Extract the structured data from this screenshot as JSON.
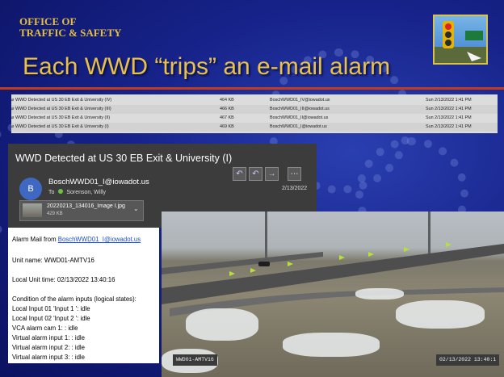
{
  "header": {
    "office_line1": "OFFICE OF",
    "office_line2": "TRAFFIC & SAFETY",
    "title": "Each WWD “trips” an e-mail alarm"
  },
  "email_list": [
    {
      "subject": "WWD Detected at US 30 EB Exit & University (IV)",
      "size": "464 KB",
      "from": "BoschWWD01_IV@iowadot.us",
      "date": "Sun 2/13/2022 1:41 PM"
    },
    {
      "subject": "WWD Detected at US 30 EB Exit & University (III)",
      "size": "466 KB",
      "from": "BoschWWD01_III@iowadot.us",
      "date": "Sun 2/13/2022 1:41 PM"
    },
    {
      "subject": "WWD Detected at US 30 EB Exit & University (II)",
      "size": "467 KB",
      "from": "BoschWWD01_II@iowadot.us",
      "date": "Sun 2/13/2022 1:41 PM"
    },
    {
      "subject": "WWD Detected at US 30 EB Exit & University (I)",
      "size": "469 KB",
      "from": "BoschWWD01_I@iowadot.us",
      "date": "Sun 2/13/2022 1:41 PM"
    }
  ],
  "email": {
    "subject": "WWD Detected at US 30 EB Exit & University (I)",
    "avatar_letter": "B",
    "from": "BoschWWD01_I@iowadot.us",
    "to_label": "To",
    "to": "Sorenson, Willy",
    "date": "2/13/2022",
    "attachment_name": "20220213_134016_Image I.jpg",
    "attachment_size": "429 KB"
  },
  "body": {
    "line1_prefix": "Alarm Mail from ",
    "line1_link": "BoschWWD01_I@iowadot.us",
    "unit_name": "Unit name: WWD01-AMTV16",
    "local_time": "Local Unit time: 02/13/2022  13:40:16",
    "condition": "Condition of the alarm inputs (logical states):",
    "input1": "Local Input  01 'Input 1    ': idle",
    "input2": "Local Input  02 'Input 2    ': idle",
    "vca": "VCA alarm cam 1:            : idle",
    "virtual1": "Virtual alarm input  1:        : idle",
    "virtual2": "Virtual alarm input  2:        : idle",
    "virtual3": "Virtual alarm input  3:        : idle"
  },
  "camera": {
    "label_left": "WWD01-AMTV16",
    "label_right": "02/13/2022  13:40:1"
  },
  "colors": {
    "slide_bg": "#17238a",
    "title": "#e8c04a",
    "accent_stripe": "#c63a1c",
    "email_panel": "#3c3c3c",
    "avatar": "#3e68c2",
    "link": "#1b4fd0",
    "detection_flag": "#b6e03a"
  },
  "icons": {
    "attachment": "paperclip-icon",
    "reply": "reply-icon",
    "reply_all": "reply-all-icon",
    "forward": "forward-icon",
    "more": "more-icon"
  }
}
